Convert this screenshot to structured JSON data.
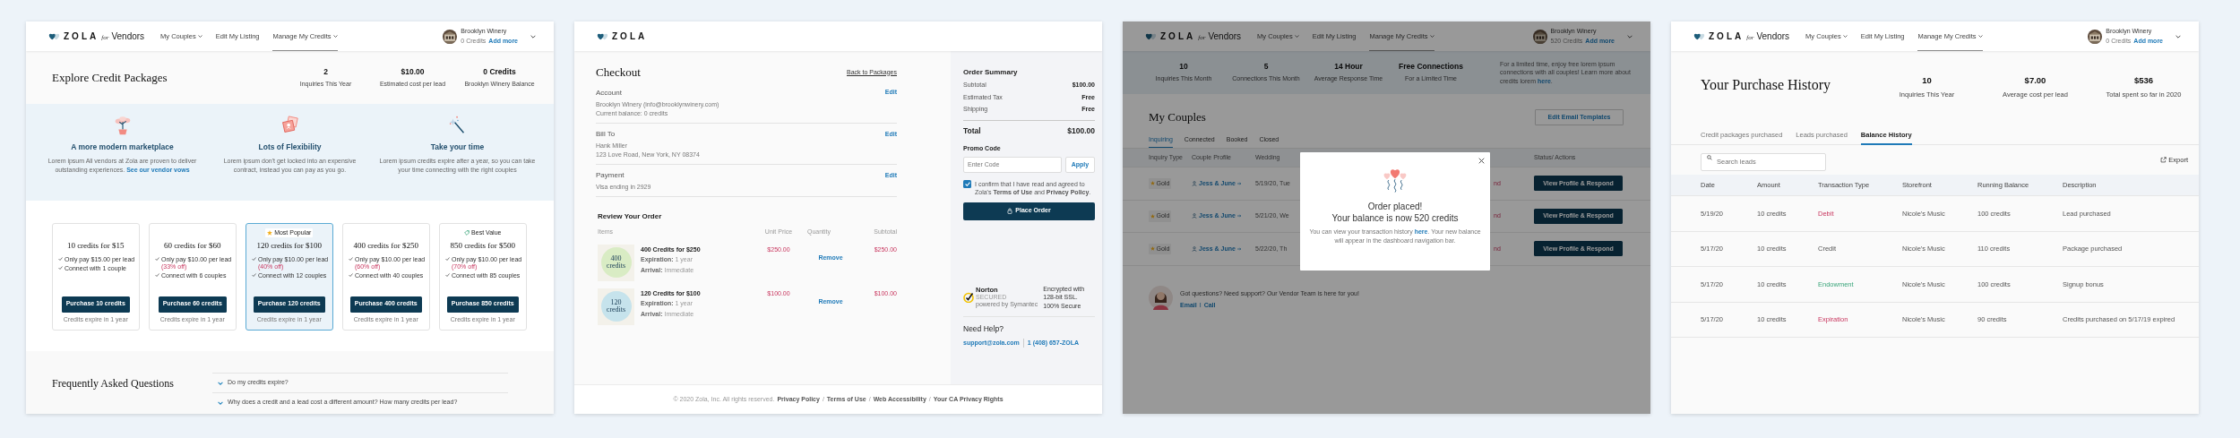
{
  "credit_packages_screen": {
    "navbar": {
      "logo": "ZOLA",
      "logo_for": "for",
      "logo_product": "Vendors",
      "items": [
        {
          "label": "My Couples",
          "dropdown": true,
          "selected": false
        },
        {
          "label": "Edit My Listing",
          "dropdown": false,
          "selected": false
        },
        {
          "label": "Manage My Credits",
          "dropdown": true,
          "selected": true
        }
      ],
      "account": {
        "name": "Brooklyn Winery",
        "credits": "0 Credits",
        "add_link": "Add more"
      }
    },
    "title": "Explore Credit Packages",
    "stats": [
      {
        "value": "2",
        "label": "Inquiries This Year"
      },
      {
        "value": "$10.00",
        "label": "Estimated cost per lead"
      },
      {
        "value": "0 Credits",
        "label": "Brooklyn Winery Balance"
      }
    ],
    "features": [
      {
        "title": "A more modern marketplace",
        "text": "Lorem ipsum All vendors at Zola are proven to deliver outstanding experiences. ",
        "link": "See our vendor vows"
      },
      {
        "title": "Lots of Flexibility",
        "text": "Lorem ipsum don't get locked into an expensive contract, instead you can pay as you go."
      },
      {
        "title": "Take your time",
        "text": "Lorem ipsum credits expire after a year, so you can take your time connecting with the right couples"
      }
    ],
    "packages": [
      {
        "title": "10 credits for $15",
        "perks": [
          {
            "text": "Only pay $15.00 per lead"
          },
          {
            "text": "Connect with 1 couple"
          }
        ],
        "button": "Purchase 10 credits",
        "note": "Credits expire in 1 year",
        "selected": false
      },
      {
        "title": "60 credits for $60",
        "perks": [
          {
            "text": "Only pay $10.00 per lead",
            "discount": "(33% off)"
          },
          {
            "text": "Connect with 6 couples"
          }
        ],
        "button": "Purchase 60 credits",
        "note": "Credits expire in 1 year",
        "selected": false
      },
      {
        "badge": {
          "kind": "star",
          "label": "Most Popular"
        },
        "title": "120 credits for $100",
        "perks": [
          {
            "text": "Only pay $10.00 per lead",
            "discount": "(40% off)"
          },
          {
            "text": "Connect with 12 couples"
          }
        ],
        "button": "Purchase 120 credits",
        "note": "Credits expire in 1 year",
        "selected": true
      },
      {
        "title": "400 credits for $250",
        "perks": [
          {
            "text": "Only pay $10.00 per lead",
            "discount": "(60% off)"
          },
          {
            "text": "Connect with 40 couples"
          }
        ],
        "button": "Purchase 400 credits",
        "note": "Credits expire in 1 year",
        "selected": false
      },
      {
        "badge": {
          "kind": "tag",
          "label": "Best Value"
        },
        "title": "850 credits for $500",
        "perks": [
          {
            "text": "Only pay $10.00 per lead",
            "discount": "(70% off)"
          },
          {
            "text": "Connect with 85 couples"
          }
        ],
        "button": "Purchase 850 credits",
        "note": "Credits expire in 1 year",
        "selected": false
      }
    ],
    "faq": {
      "title": "Frequently Asked Questions",
      "items": [
        {
          "question": "Do my credits expire?",
          "expanded": false
        },
        {
          "question": "Why does a credit and a lead cost a different amount? How many credits per lead?",
          "expanded": false
        }
      ]
    }
  },
  "checkout_screen": {
    "navbar": {
      "logo": "ZOLA"
    },
    "title": "Checkout",
    "back_link": "Back to Packages",
    "sections": [
      {
        "heading": "Account",
        "edit": "Edit",
        "lines": [
          "Brooklyn Winery (info@brooklynwinery.com)",
          "Current balance: 0 credits"
        ]
      },
      {
        "heading": "Bill To",
        "edit": "Edit",
        "lines": [
          "Hank Miller",
          "123 Love Road, New York, NY 08374"
        ]
      },
      {
        "heading": "Payment",
        "edit": "Edit",
        "lines": [
          "Visa ending in 2929"
        ]
      }
    ],
    "review": {
      "title": "Review Your Order",
      "columns": [
        "Items",
        "Unit Price",
        "Quantity",
        "Subtotal"
      ],
      "items": [
        {
          "image_amount": "400",
          "image_unit": "credits",
          "color": "#d9ecc4",
          "name": "400 Credits for $250",
          "details": [
            {
              "label": "Expiration:",
              "value": "1 year"
            },
            {
              "label": "Arrival:",
              "value": "Immediate"
            }
          ],
          "unit_price": "$250.00",
          "action": "Remove",
          "subtotal": "$250.00"
        },
        {
          "image_amount": "120",
          "image_unit": "credits",
          "color": "#c6e3ec",
          "name": "120 Credits for $100",
          "details": [
            {
              "label": "Expiration:",
              "value": "1 year"
            },
            {
              "label": "Arrival:",
              "value": "Immediate"
            }
          ],
          "unit_price": "$100.00",
          "action": "Remove",
          "subtotal": "$100.00"
        }
      ]
    },
    "summary": {
      "title": "Order Summary",
      "lines": [
        {
          "label": "Subtotal",
          "value": "$100.00"
        },
        {
          "label": "Estimated Tax",
          "value": "Free"
        },
        {
          "label": "Shipping",
          "value": "Free"
        }
      ],
      "total_label": "Total",
      "total": "$100.00",
      "promo_label": "Promo Code",
      "promo_placeholder": "Enter Code",
      "apply": "Apply",
      "confirm_checked": true,
      "confirm_text": "I confirm that I have read and agreed to Zola's **Terms of Use** and **Privacy Policy**.",
      "place_order": "Place Order",
      "seal_brand": "Norton",
      "seal_sub": "SECURED",
      "seal_powered": "powered by Symantec",
      "secure_text": "Encrypted with 128-bit SSL. 100% Secure",
      "help_title": "Need Help?",
      "help_links": [
        "support@zola.com",
        "1 (408) 657-ZOLA"
      ]
    },
    "footer": {
      "copyright": "© 2020 Zola, Inc. All rights reserved.",
      "separator": "/",
      "links": [
        "Privacy Policy",
        "Terms of Use",
        "Web Accessibility",
        "Your CA Privacy Rights"
      ]
    }
  },
  "couples_screen": {
    "navbar": {
      "logo": "ZOLA",
      "logo_for": "for",
      "logo_product": "Vendors",
      "items": [
        {
          "label": "My Couples",
          "dropdown": true,
          "selected": false
        },
        {
          "label": "Edit My Listing",
          "dropdown": false,
          "selected": false
        },
        {
          "label": "Manage My Credits",
          "dropdown": true,
          "selected": true
        }
      ],
      "account": {
        "name": "Brooklyn Winery",
        "credits": "520 Credits",
        "add_link": "Add more"
      }
    },
    "stats": [
      {
        "value": "10",
        "label": "Inquiries This Month"
      },
      {
        "value": "5",
        "label": "Connections This Month"
      },
      {
        "value": "14 Hour",
        "label": "Average Response Time"
      },
      {
        "value": "Free Connections",
        "label": "For a Limited Time"
      }
    ],
    "promo": {
      "text": "For a limited time, enjoy free lorem ipsum connections with all couples! Learn more about credits lorem ",
      "link": "here",
      "end": "."
    },
    "title": "My Couples",
    "templates_button": "Edit Email Templates",
    "tabs": [
      {
        "label": "Inquiring",
        "selected": true
      },
      {
        "label": "Connected",
        "selected": false
      },
      {
        "label": "Booked",
        "selected": false
      },
      {
        "label": "Closed",
        "selected": false
      }
    ],
    "columns": [
      "Inquiry Type",
      "Couple Profile",
      "Wedding",
      "Status/ Actions"
    ],
    "rows": [
      {
        "type": "Gold",
        "couple": "Jess & June",
        "wedding": "5/19/20, Tue",
        "status": "nd",
        "action": "View Profile & Respond"
      },
      {
        "type": "Gold",
        "couple": "Jess & June",
        "wedding": "5/21/20, We",
        "status": "nd",
        "action": "View Profile & Respond"
      },
      {
        "type": "Gold",
        "couple": "Jess & June",
        "wedding": "5/22/20, Th",
        "status": "nd",
        "action": "View Profile & Respond"
      }
    ],
    "support": {
      "text": "Got questions? Need support? Our Vendor Team is here for you!",
      "links": [
        "Email",
        "Call"
      ],
      "separator": "I"
    },
    "dialog": {
      "title": "Order placed!",
      "headline": "Your balance is now 520 credits",
      "text": "You can view your transaction history ",
      "link": "here",
      "end": ". Your new balance will appear in the dashboard navigation bar."
    }
  },
  "purchase_history_screen": {
    "navbar": {
      "logo": "ZOLA",
      "logo_for": "for",
      "logo_product": "Vendors",
      "items": [
        {
          "label": "My Couples",
          "dropdown": true,
          "selected": false
        },
        {
          "label": "Edit My Listing",
          "dropdown": false,
          "selected": false
        },
        {
          "label": "Manage My Credits",
          "dropdown": true,
          "selected": true
        }
      ],
      "account": {
        "name": "Brooklyn Winery",
        "credits": "0 Credits",
        "add_link": "Add more"
      }
    },
    "title": "Your Purchase History",
    "stats": [
      {
        "value": "10",
        "label": "Inquiries This Year"
      },
      {
        "value": "$7.00",
        "label": "Average cost per lead"
      },
      {
        "value": "$536",
        "label": "Total spent so far in 2020"
      }
    ],
    "tabs": [
      {
        "label": "Credit packages purchased",
        "selected": false
      },
      {
        "label": "Leads purchased",
        "selected": false
      },
      {
        "label": "Balance History",
        "selected": true
      }
    ],
    "search_placeholder": "Search leads",
    "export": "Export",
    "columns": [
      "Date",
      "Amount",
      "Transaction Type",
      "Storefront",
      "Running Balance",
      "Description"
    ],
    "rows": [
      {
        "date": "5/19/20",
        "amount": "10 credits",
        "type": "Debit",
        "kind": "debit",
        "storefront": "Nicole's Music",
        "balance": "100 credits",
        "description": "Lead purchased"
      },
      {
        "date": "5/17/20",
        "amount": "10 credits",
        "type": "Credit",
        "kind": "credit",
        "storefront": "Nicole's Music",
        "balance": "110 credits",
        "description": "Package purchased"
      },
      {
        "date": "5/17/20",
        "amount": "10 credits",
        "type": "Endowment",
        "kind": "endowment",
        "storefront": "Nicole's Music",
        "balance": "100 credits",
        "description": "Signup bonus"
      },
      {
        "date": "5/17/20",
        "amount": "10 credits",
        "type": "Expiration",
        "kind": "expiration",
        "storefront": "Nicole's Music",
        "balance": "90 credits",
        "description": "Credits purchased on 5/17/19 expired"
      }
    ]
  }
}
